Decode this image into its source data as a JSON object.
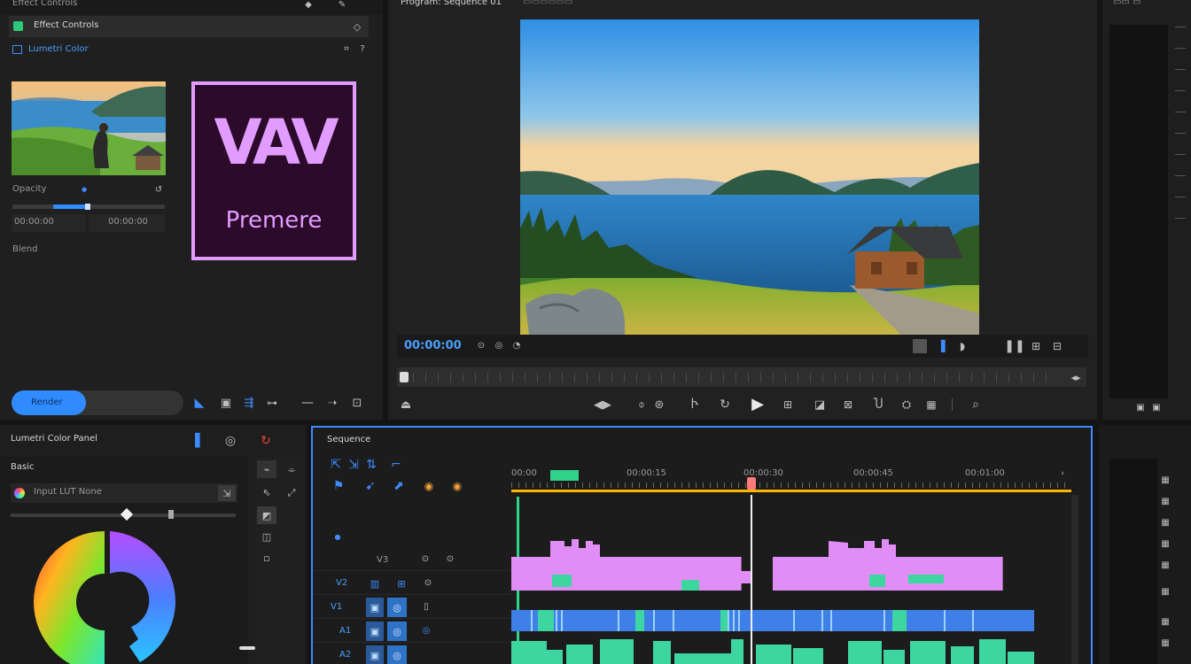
{
  "project_panel": {
    "header_left": "Effect Controls",
    "row1_label": "Effect Controls",
    "row2_label": "Lumetri Color",
    "clip_label": "Opacity",
    "left_value": "00:00:00",
    "right_value": "00:00:00",
    "extra_label": "Blend",
    "button_label": "Render",
    "logo_text": "Premere",
    "logo_mark": "VAV"
  },
  "program_monitor": {
    "title": "Program: Sequence 01",
    "timecode": "00:00:00"
  },
  "lumetri_panel": {
    "title": "Lumetri Color Panel",
    "section_label": "Basic",
    "field_label": "Input LUT  None"
  },
  "timeline": {
    "title": "Sequence",
    "ruler_labels": [
      "00:00",
      "00:00:15",
      "00:00:30",
      "00:00:45",
      "00:01:00"
    ],
    "track_labels": [
      "V3",
      "V2",
      "V1",
      "A1",
      "A2"
    ],
    "clips": {
      "pink": [
        {
          "start": 0,
          "end": 0.44
        },
        {
          "start": 0.5,
          "end": 0.94
        }
      ]
    }
  },
  "colors": {
    "accent_blue": "#2f8bff",
    "timeline_pink": "#e18df6",
    "timeline_blue": "#3f7fe8",
    "timeline_teal": "#3ed6a0",
    "playhead": "#f0f0f0",
    "ruler_orange": "#ffb400",
    "logo_bg": "#2b0a2a",
    "logo_border": "#e29cff"
  },
  "icons": [
    "play-icon",
    "step-back-icon",
    "step-forward-icon",
    "export-icon",
    "settings-icon",
    "zoom-icon",
    "marker-icon",
    "wrench-icon"
  ]
}
